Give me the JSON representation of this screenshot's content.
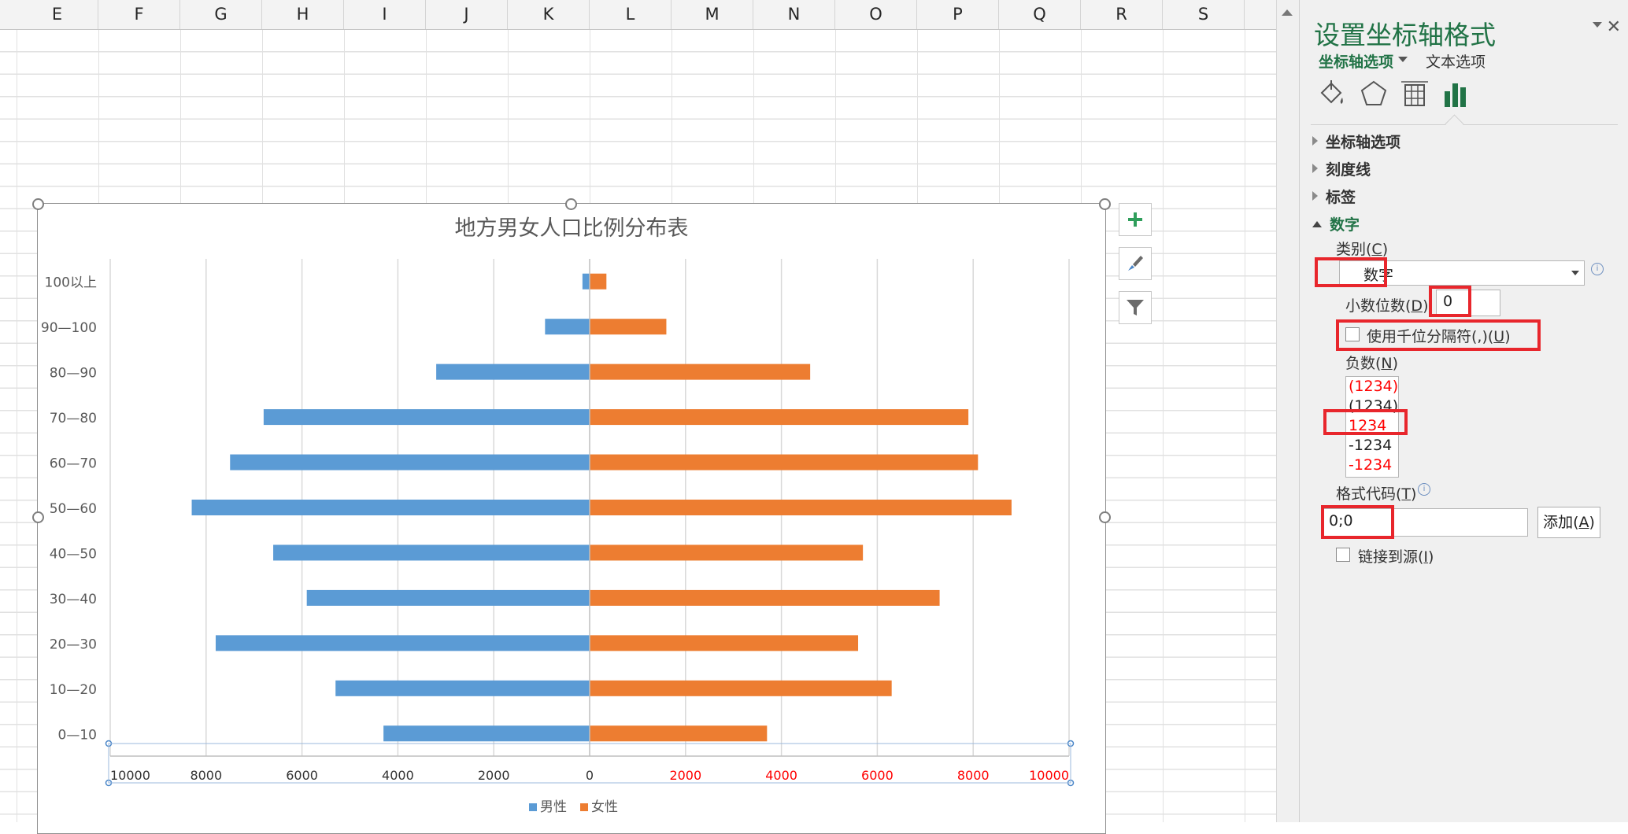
{
  "columns": [
    "E",
    "F",
    "G",
    "H",
    "I",
    "J",
    "K",
    "L",
    "M",
    "N",
    "O",
    "P",
    "Q",
    "R",
    "S"
  ],
  "chart": {
    "title": "地方男女人口比例分布表",
    "tools": [
      "add-element",
      "chart-style",
      "chart-filter"
    ]
  },
  "chart_data": {
    "type": "bar",
    "orientation": "horizontal",
    "title": "地方男女人口比例分布表",
    "categories": [
      "0—10",
      "10—20",
      "20—30",
      "30—40",
      "40—50",
      "50—60",
      "60—70",
      "70—80",
      "80—90",
      "90—100",
      "100以上"
    ],
    "series": [
      {
        "name": "男性",
        "color": "#5b9bd5",
        "values": [
          -4300,
          -5300,
          -7800,
          -5900,
          -6600,
          -8300,
          -7500,
          -6800,
          -3200,
          -930,
          -150
        ]
      },
      {
        "name": "女性",
        "color": "#ed7d31",
        "values": [
          3700,
          6300,
          5600,
          7300,
          5700,
          8800,
          8100,
          7900,
          4600,
          1600,
          350
        ]
      }
    ],
    "xlim": [
      -10000,
      10000
    ],
    "x_tick_labels": [
      "10000",
      "8000",
      "6000",
      "4000",
      "2000",
      "0",
      "2000",
      "4000",
      "6000",
      "8000",
      "10000"
    ],
    "negative_tick_color": "#333333",
    "positive_tick_color": "#ff0000",
    "grid": "vertical",
    "legend": "bottom"
  },
  "pane": {
    "title": "设置坐标轴格式",
    "tab_axis": "坐标轴选项",
    "tab_text": "文本选项",
    "icons": [
      "fill-line-icon",
      "effects-pentagon-icon",
      "size-properties-icon",
      "axis-options-chart-icon"
    ],
    "sections": {
      "axis_options": "坐标轴选项",
      "tick_marks": "刻度线",
      "labels": "标签",
      "number": "数字"
    },
    "category_label": "类别(",
    "category_key": "C",
    "category_value": "数字",
    "decimals_label": "小数位数(",
    "decimals_key": "D",
    "decimals_suffix": "):",
    "decimals_value": "0",
    "thousands_label": "使用千位分隔符(,)(",
    "thousands_key": "U",
    "negative_label": "负数(",
    "negative_key": "N",
    "negative_options": [
      {
        "text": "(1234)",
        "color": "#ff0000"
      },
      {
        "text": "(1234)",
        "color": "#222222"
      },
      {
        "text": "1234",
        "color": "#ff0000"
      },
      {
        "text": "-1234",
        "color": "#222222"
      },
      {
        "text": "-1234",
        "color": "#ff0000"
      }
    ],
    "format_code_label": "格式代码(",
    "format_code_key": "T",
    "format_code_value": "0;0",
    "add_label": "添加(",
    "add_key": "A",
    "link_label": "链接到源(",
    "link_key": "I",
    "paren_close": ")",
    "accent_color": "#217346",
    "highlight_color": "#e8262c"
  }
}
